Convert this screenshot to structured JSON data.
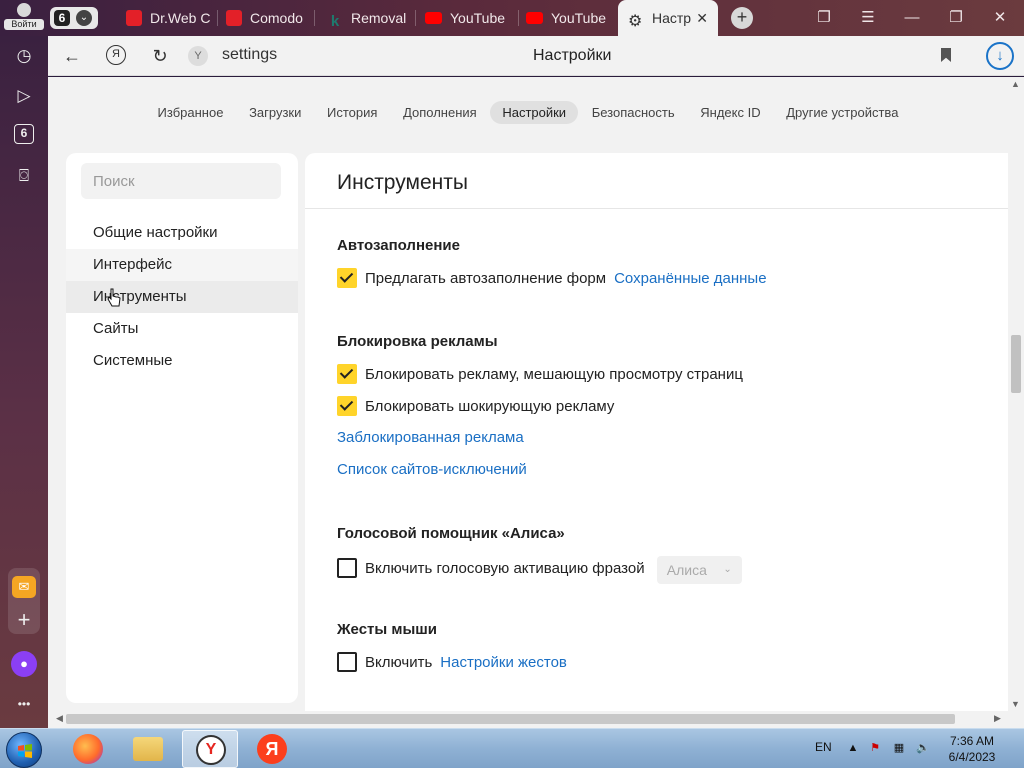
{
  "browser": {
    "login_label": "Войти",
    "tab_count": "6",
    "tabs": [
      {
        "title": "Dr.Web C",
        "color": "#e32028"
      },
      {
        "title": "Comodo",
        "color": "#e32028"
      },
      {
        "title": "Removal",
        "color": "#1f7a6e"
      },
      {
        "title": "YouTube",
        "color": "#ff0000"
      },
      {
        "title": "YouTube",
        "color": "#ff0000"
      },
      {
        "title": "Настр",
        "color": "#333333"
      }
    ],
    "new_tab_label": "+",
    "url": "settings",
    "page_title": "Настройки"
  },
  "sidepanel": {
    "tab_badge": "6",
    "more_label": "•••"
  },
  "settings": {
    "top_nav": [
      "Избранное",
      "Загрузки",
      "История",
      "Дополнения",
      "Настройки",
      "Безопасность",
      "Яндекс ID",
      "Другие устройства"
    ],
    "top_nav_active": "Настройки",
    "search_placeholder": "Поиск",
    "menu": [
      "Общие настройки",
      "Интерфейс",
      "Инструменты",
      "Сайты",
      "Системные"
    ],
    "menu_selected": "Инструменты",
    "section_title": "Инструменты",
    "autofill": {
      "title": "Автозаполнение",
      "option": "Предлагать автозаполнение форм",
      "option_checked": true,
      "link": "Сохранённые данные"
    },
    "adblock": {
      "title": "Блокировка рекламы",
      "option1": "Блокировать рекламу, мешающую просмотру страниц",
      "option1_checked": true,
      "option2": "Блокировать шокирующую рекламу",
      "option2_checked": true,
      "link1": "Заблокированная реклама",
      "link2": "Список сайтов-исключений"
    },
    "alice": {
      "title": "Голосовой помощник «Алиса»",
      "option": "Включить голосовую активацию фразой",
      "option_checked": false,
      "dropdown_value": "Алиса"
    },
    "gestures": {
      "title": "Жесты мыши",
      "option": "Включить",
      "option_checked": false,
      "link": "Настройки жестов"
    }
  },
  "taskbar": {
    "yandex_letter": "Я",
    "language": "EN",
    "time": "7:36 AM",
    "date": "6/4/2023"
  },
  "colors": {
    "checkbox_checked": "#ffd42a",
    "link": "#1a6fc4",
    "accent": "#1a73c8"
  }
}
